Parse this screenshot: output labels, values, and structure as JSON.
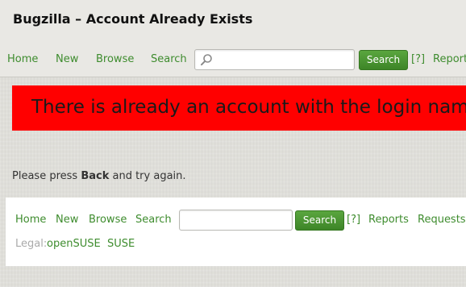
{
  "header": {
    "title": "Bugzilla – Account Already Exists"
  },
  "nav": {
    "home": "Home",
    "new": "New",
    "browse": "Browse",
    "search": "Search",
    "search_button": "Search",
    "help": "[?]",
    "reports": "Report"
  },
  "banner": {
    "text": "There is already an account with the login name"
  },
  "message": {
    "prefix": "Please press ",
    "bold": "Back",
    "suffix": " and try again."
  },
  "footer": {
    "nav": {
      "home": "Home",
      "new": "New",
      "browse": "Browse",
      "search": "Search",
      "search_button": "Search",
      "help": "[?]",
      "reports": "Reports",
      "requests": "Requests"
    },
    "legal": {
      "label": "Legal:",
      "opensuse": "openSUSE",
      "suse": "SUSE"
    }
  },
  "colors": {
    "link": "#3e8c2e",
    "button": "#4a9634",
    "banner": "#ff0000"
  }
}
